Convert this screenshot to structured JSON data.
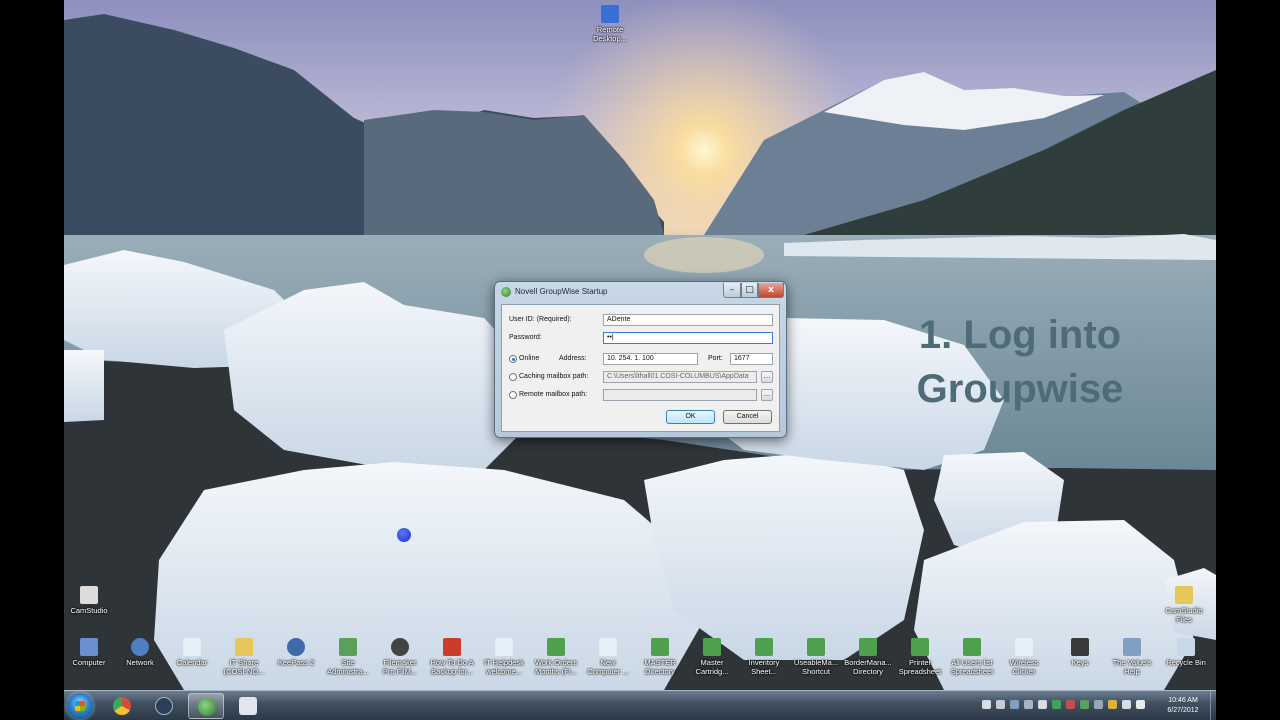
{
  "desktop_icons": [
    {
      "id": "remote",
      "label": "Remote\nDesktop...",
      "color": "#3a6fd8"
    },
    {
      "id": "camstudio",
      "label": "CamStudio",
      "color": "#dcdcdc"
    },
    {
      "id": "camstudio-files",
      "label": "CamStudio\nFiles",
      "color": "#e8c75a"
    },
    {
      "id": "computer",
      "label": "Computer",
      "color": "#6a8fd0"
    },
    {
      "id": "network",
      "label": "Network",
      "color": "#4f7fc0"
    },
    {
      "id": "calendar",
      "label": "Calendar",
      "color": "#e6f0f8"
    },
    {
      "id": "it-share",
      "label": "IT Share\n(COSI-NO...",
      "color": "#e8c75a"
    },
    {
      "id": "keepass",
      "label": "KeePass 2",
      "color": "#3f6aa8"
    },
    {
      "id": "site-admin",
      "label": "Site\nAdministra...",
      "color": "#5aa05a"
    },
    {
      "id": "filemaker",
      "label": "Filemaker\nPro FilM...",
      "color": "#444444"
    },
    {
      "id": "how-to",
      "label": "How To Do A\nBackup for...",
      "color": "#cc3b2b"
    },
    {
      "id": "it-helpdesk",
      "label": "IT Helpdesk\nwelcome...",
      "color": "#e6f0f8"
    },
    {
      "id": "work-order",
      "label": "Work Orders\nMonths (FI...",
      "color": "#4ea04e"
    },
    {
      "id": "new-computer",
      "label": "New\nComputer ...",
      "color": "#e6f0f8"
    },
    {
      "id": "master-directory",
      "label": "MASTER\nDirectory",
      "color": "#4ea04e"
    },
    {
      "id": "master-cartridge",
      "label": "Master\nCartridg...",
      "color": "#4ea04e"
    },
    {
      "id": "inventory",
      "label": "Inventory\nSheet...",
      "color": "#4ea04e"
    },
    {
      "id": "useable",
      "label": "UseableMa...\nShortcut",
      "color": "#4ea04e"
    },
    {
      "id": "border",
      "label": "BorderMana...\nDirectory",
      "color": "#4ea04e"
    },
    {
      "id": "printer-spreadsheet",
      "label": "Printer\nSpreadsheet",
      "color": "#4ea04e"
    },
    {
      "id": "all-users",
      "label": "All Users list\nSpreadsheet",
      "color": "#4ea04e"
    },
    {
      "id": "wireless",
      "label": "Wireless\nClicker",
      "color": "#e6f0f8"
    },
    {
      "id": "keys",
      "label": "Keys",
      "color": "#3a3a3a"
    },
    {
      "id": "tax-help",
      "label": "The Value's\nHelp",
      "color": "#7fa0c0"
    },
    {
      "id": "recycle-bin",
      "label": "Recycle Bin",
      "color": "#c8d8e8"
    }
  ],
  "caption": {
    "line1": "1. Log into",
    "line2": "Groupwise"
  },
  "dialog": {
    "title": "Novell GroupWise Startup",
    "user_id_label": "User ID: (Required):",
    "user_id_value": "ADente",
    "password_label": "Password:",
    "password_value": "••|",
    "online_label": "Online",
    "address_label": "Address:",
    "address_value": "10. 254. 1. 100",
    "port_label": "Port:",
    "port_value": "1677",
    "caching_label": "Caching mailbox path:",
    "caching_value": "C:\\Users\\lthall01.COSI-COLUMBUS\\AppData",
    "remote_label": "Remote mailbox path:",
    "remote_value": "",
    "browse_label": "...",
    "ok_label": "OK",
    "cancel_label": "Cancel",
    "min_label": "–",
    "max_label": "□",
    "close_label": "x"
  },
  "taskbar": {
    "clock_time": "10:46 AM",
    "clock_date": "6/27/2012",
    "buttons": [
      {
        "id": "chrome",
        "color": "#d84a38"
      },
      {
        "id": "tt-app",
        "color": "#2d3e5a"
      },
      {
        "id": "groupwise",
        "color": "#3fa35a"
      },
      {
        "id": "window",
        "color": "#e0e6ee"
      }
    ]
  }
}
